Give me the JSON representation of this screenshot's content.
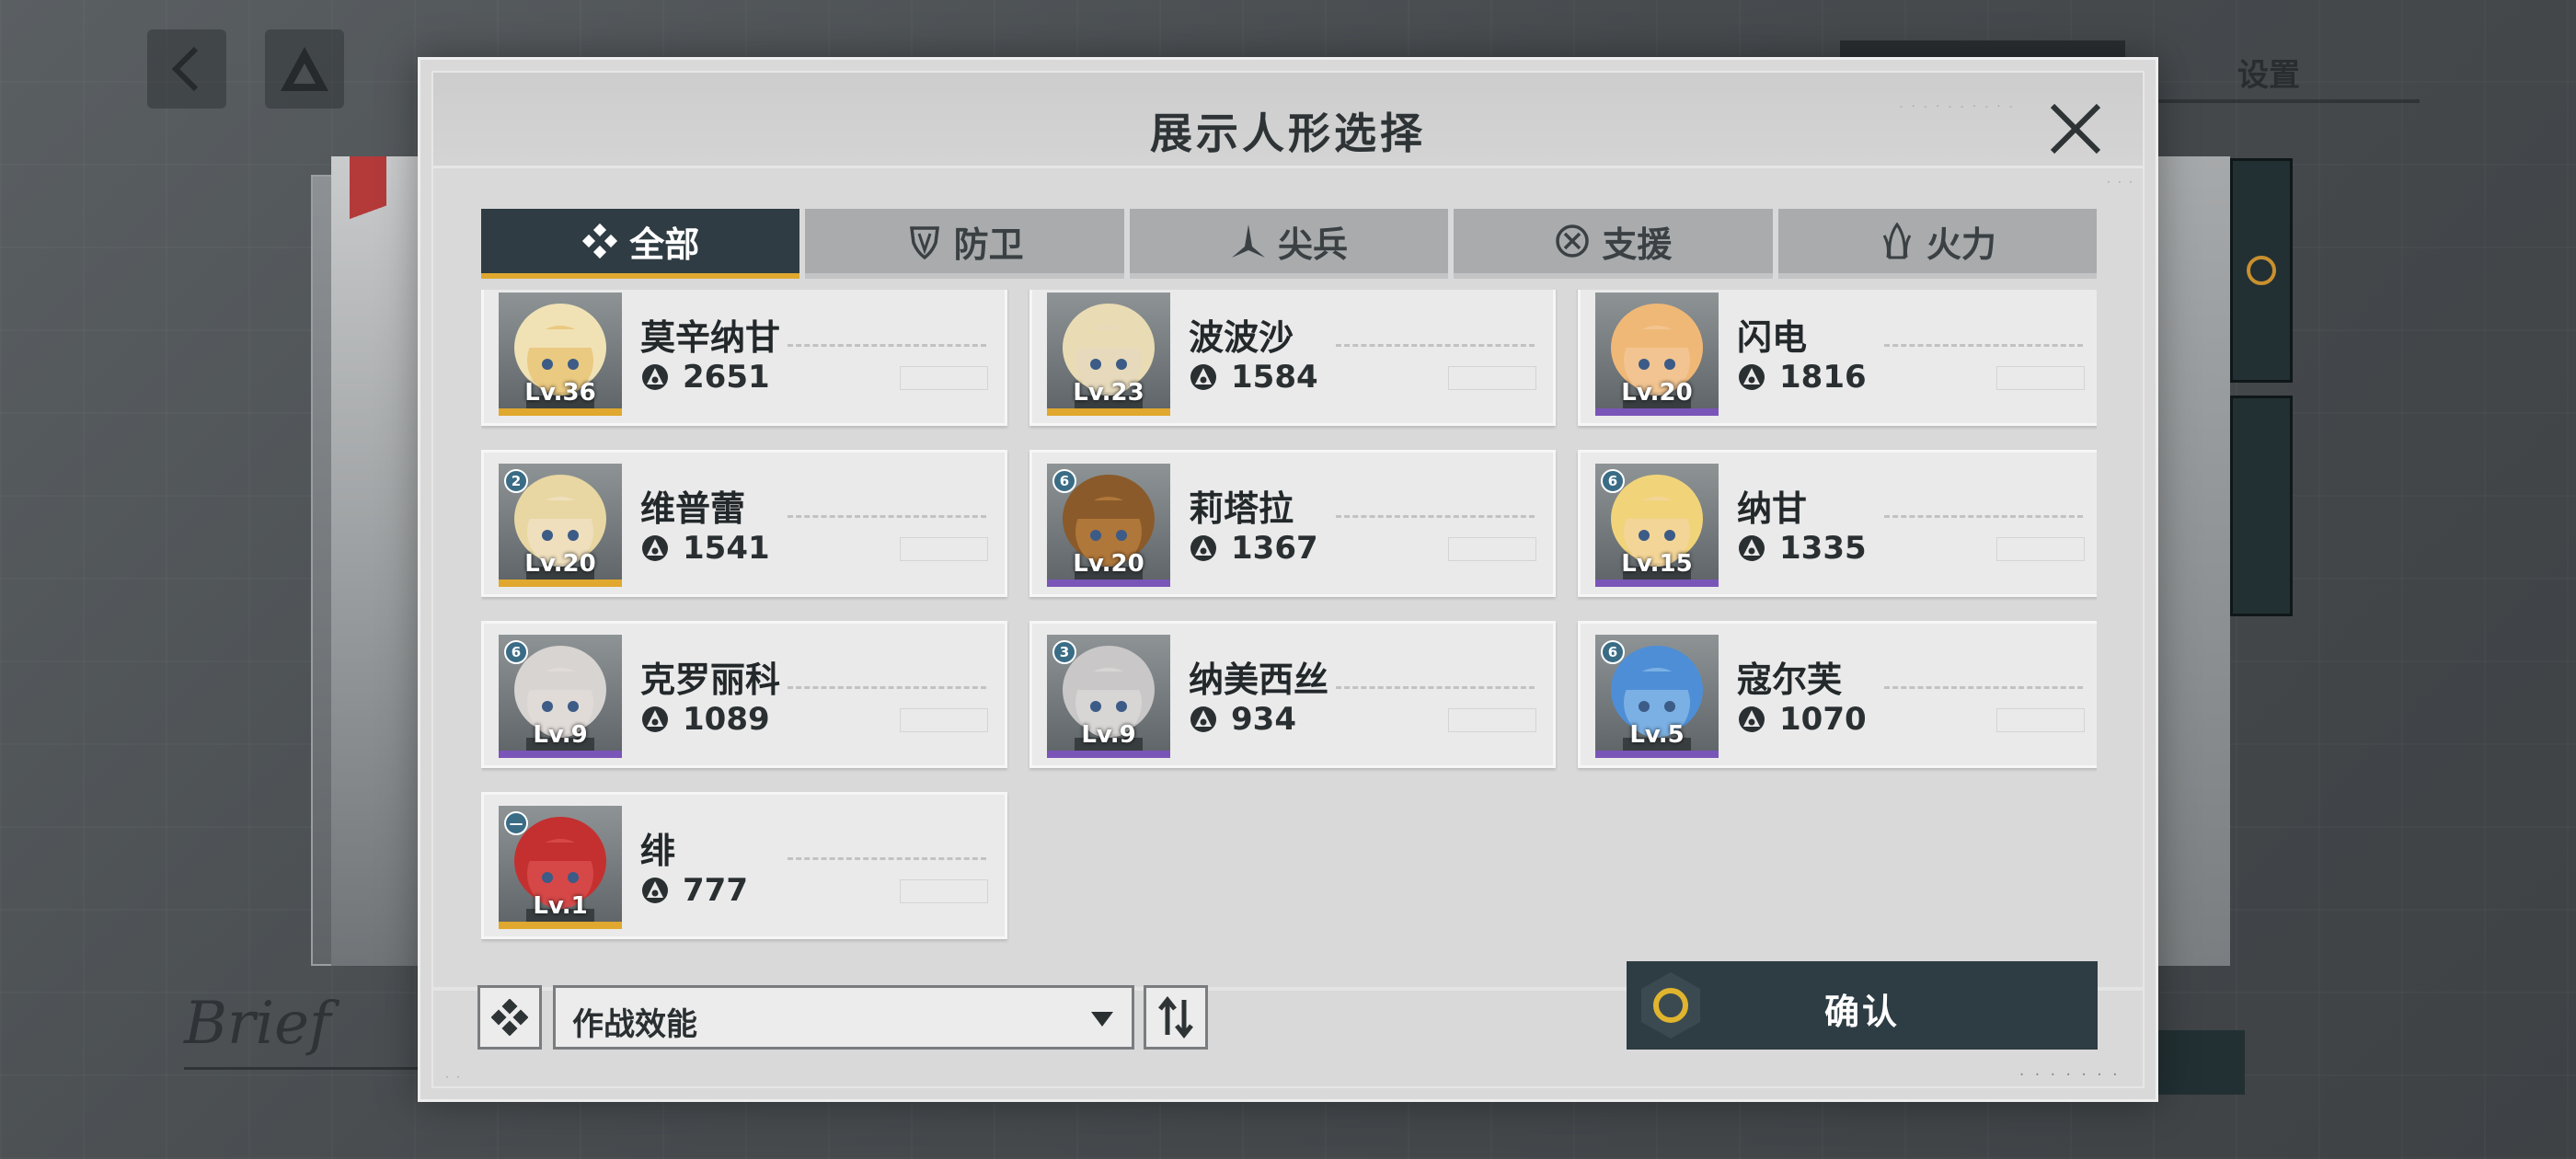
{
  "background": {
    "settings_label": "设置",
    "brief_text": "Brief"
  },
  "dialog": {
    "title": "展示人形选择",
    "tabs": [
      {
        "label": "全部",
        "icon": "all-diamond-icon",
        "active": true
      },
      {
        "label": "防卫",
        "icon": "shield-icon",
        "active": false
      },
      {
        "label": "尖兵",
        "icon": "vanguard-icon",
        "active": false
      },
      {
        "label": "支援",
        "icon": "support-icon",
        "active": false
      },
      {
        "label": "火力",
        "icon": "firepower-icon",
        "active": false
      }
    ],
    "dolls": [
      {
        "name": "莫辛纳甘",
        "level": "Lv.36",
        "power": "2651",
        "rank": "",
        "bar_color": "#e0a82e",
        "skin": "#e9c77a",
        "hair": "#f1e2b5"
      },
      {
        "name": "波波沙",
        "level": "Lv.23",
        "power": "1584",
        "rank": "",
        "bar_color": "#e0a82e",
        "skin": "#e7d9bd",
        "hair": "#e9dcb4"
      },
      {
        "name": "闪电",
        "level": "Lv.20",
        "power": "1816",
        "rank": "",
        "bar_color": "#7a55b8",
        "skin": "#f2c593",
        "hair": "#f0b877"
      },
      {
        "name": "维普蕾",
        "level": "Lv.20",
        "power": "1541",
        "rank": "2",
        "bar_color": "#e0a82e",
        "skin": "#efe0c0",
        "hair": "#e8d7a2"
      },
      {
        "name": "莉塔拉",
        "level": "Lv.20",
        "power": "1367",
        "rank": "6",
        "bar_color": "#7a55b8",
        "skin": "#b47a3c",
        "hair": "#8a5a2a"
      },
      {
        "name": "纳甘",
        "level": "Lv.15",
        "power": "1335",
        "rank": "6",
        "bar_color": "#7a55b8",
        "skin": "#f3d59a",
        "hair": "#f1d47a"
      },
      {
        "name": "克罗丽科",
        "level": "Lv.9",
        "power": "1089",
        "rank": "6",
        "bar_color": "#7a55b8",
        "skin": "#e2dcd8",
        "hair": "#d8d4d2"
      },
      {
        "name": "纳美西丝",
        "level": "Lv.9",
        "power": "934",
        "rank": "3",
        "bar_color": "#7a55b8",
        "skin": "#d9d6d6",
        "hair": "#c9c7c7"
      },
      {
        "name": "寇尔芙",
        "level": "Lv.5",
        "power": "1070",
        "rank": "6",
        "bar_color": "#7a55b8",
        "skin": "#7fb4e6",
        "hair": "#4e8ed6"
      },
      {
        "name": "绯",
        "level": "Lv.1",
        "power": "777",
        "rank": "—",
        "bar_color": "#e0a82e",
        "skin": "#d84a4a",
        "hair": "#c43030"
      }
    ],
    "sort": {
      "label": "作战效能",
      "filter_icon": "diamond-filter-icon",
      "order_icon": "sort-order-icon"
    },
    "confirm_label": "确认"
  }
}
